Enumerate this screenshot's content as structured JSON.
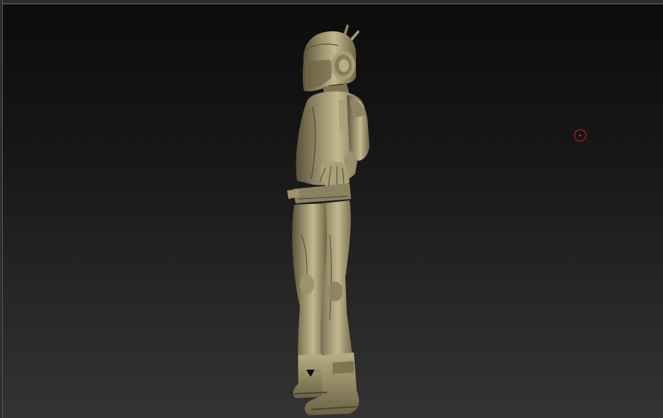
{
  "viewport": {
    "background_top": "#0c0c0c",
    "background_bottom": "#333333",
    "frame_color": "#2e2e2e"
  },
  "model": {
    "material_base": "#9a916e",
    "material_light": "#c2b98f",
    "material_shadow": "#5a5338",
    "material_dark": "#3a3524"
  },
  "marker": {
    "icon": "target-circle-icon",
    "color": "#c62626"
  },
  "cursor": {
    "icon": "cursor-pointer-icon"
  }
}
